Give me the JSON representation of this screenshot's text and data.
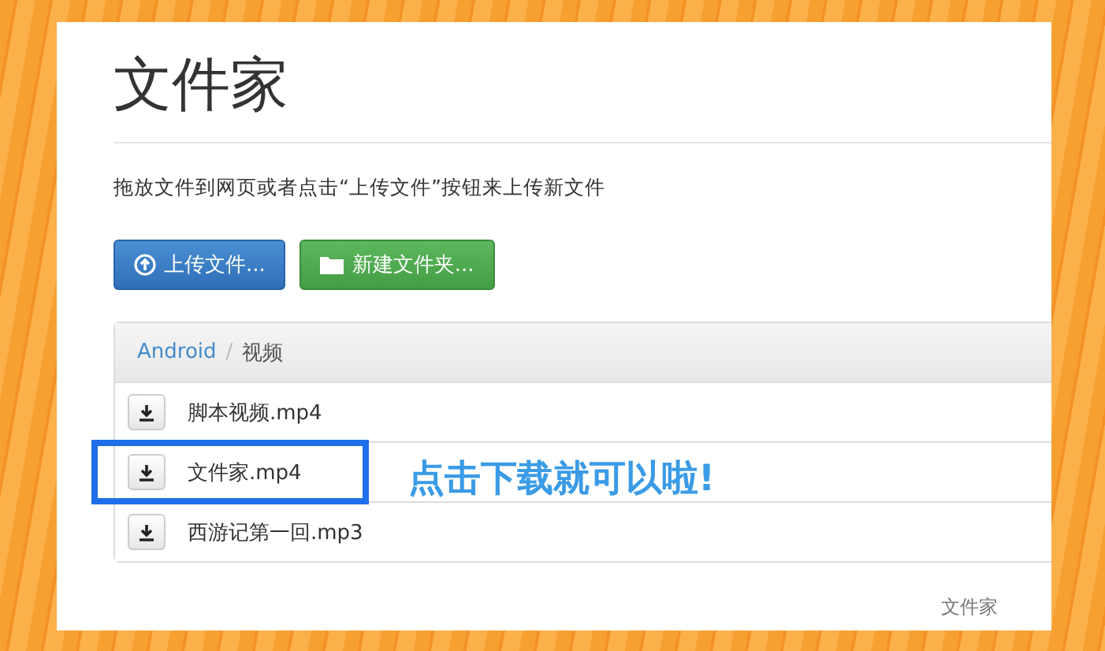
{
  "header": {
    "title": "文件家"
  },
  "instructions": "拖放文件到网页或者点击“上传文件”按钮来上传新文件",
  "buttons": [
    {
      "kind": "upload",
      "label": "上传文件..."
    },
    {
      "kind": "folder",
      "label": "新建文件夹..."
    }
  ],
  "breadcrumb": [
    {
      "label": "Android",
      "link": true
    },
    {
      "label": "视频",
      "link": false
    }
  ],
  "breadcrumb_separator": "/",
  "files": [
    {
      "name": "脚本视频.mp4",
      "highlighted": false
    },
    {
      "name": "文件家.mp4",
      "highlighted": true
    },
    {
      "name": "西游记第一回.mp3",
      "highlighted": false
    }
  ],
  "annotation": "点击下载就可以啦!",
  "footer": "文件家"
}
